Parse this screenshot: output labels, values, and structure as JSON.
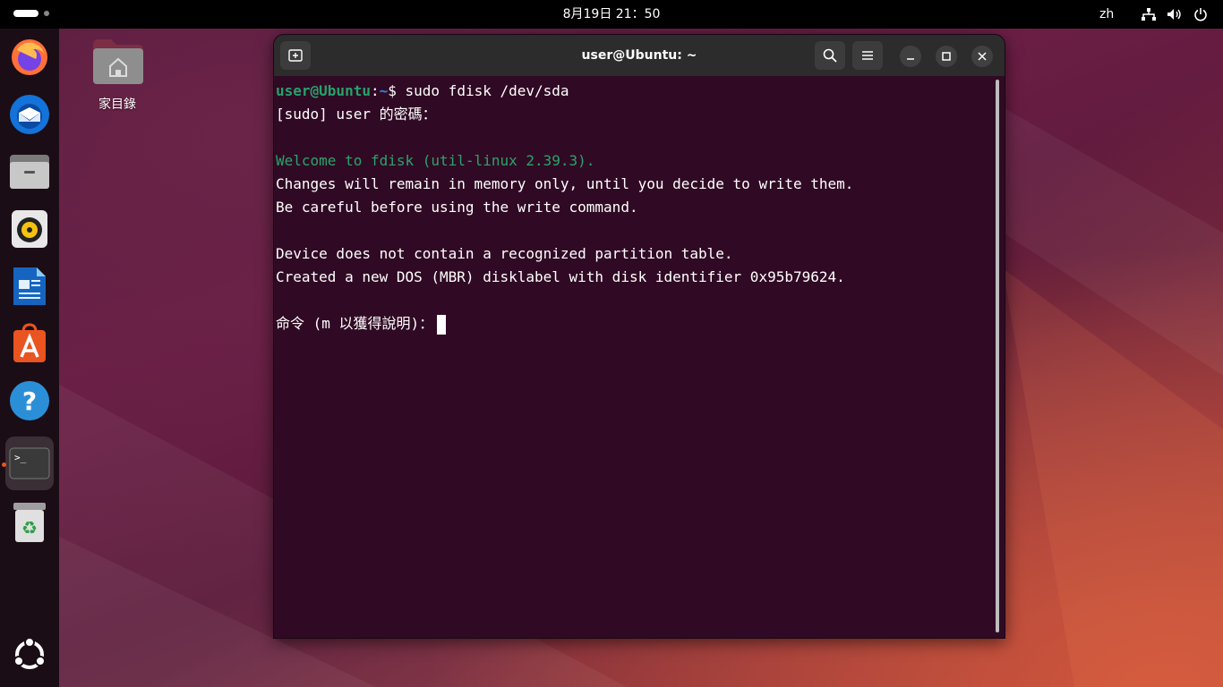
{
  "topbar": {
    "clock": "8月19日 21：50",
    "language": "zh"
  },
  "dock": {
    "items": [
      {
        "name": "firefox-icon"
      },
      {
        "name": "thunderbird-icon"
      },
      {
        "name": "files-icon"
      },
      {
        "name": "rhythmbox-icon"
      },
      {
        "name": "libreoffice-writer-icon"
      },
      {
        "name": "app-center-icon"
      },
      {
        "name": "help-icon"
      },
      {
        "name": "terminal-icon"
      },
      {
        "name": "trash-icon"
      },
      {
        "name": "show-apps-icon"
      }
    ]
  },
  "desktop": {
    "home_label": "家目錄"
  },
  "window": {
    "title": "user@Ubuntu: ~",
    "terminal": {
      "prompt_user": "user@Ubuntu",
      "prompt_sep": ":",
      "prompt_path": "~",
      "prompt_symbol": "$ ",
      "command": "sudo fdisk /dev/sda",
      "lines": [
        "[sudo] user 的密碼：",
        "",
        "Welcome to fdisk (util-linux 2.39.3).",
        "Changes will remain in memory only, until you decide to write them.",
        "Be careful before using the write command.",
        "",
        "Device does not contain a recognized partition table.",
        "Created a new DOS (MBR) disklabel with disk identifier 0x95b79624.",
        ""
      ],
      "input_prompt": "命令 (m 以獲得說明)："
    }
  },
  "colors": {
    "terminal_bg": "#300a24",
    "prompt_user": "#26a269",
    "prompt_path": "#3584e4",
    "welcome_text": "#2ba36b",
    "accent": "#e95420"
  }
}
